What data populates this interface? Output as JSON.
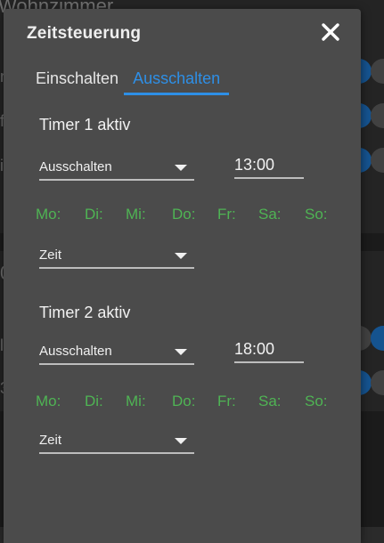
{
  "background": {
    "title": "Wohnzimmer",
    "letters": [
      "r",
      "f",
      "i",
      "0",
      "l",
      "3"
    ]
  },
  "dialog": {
    "title": "Zeitsteuerung",
    "close_icon": "close-icon",
    "tabs": [
      {
        "label": "Einschalten",
        "active": false
      },
      {
        "label": "Ausschalten",
        "active": true
      }
    ],
    "timers": [
      {
        "heading": "Timer 1 aktiv",
        "action": "Ausschalten",
        "time": "13:00",
        "days": [
          "Mo:",
          "Di:",
          "Mi:",
          "Do:",
          "Fr:",
          "Sa:",
          "So:"
        ],
        "mode": "Zeit"
      },
      {
        "heading": "Timer 2 aktiv",
        "action": "Ausschalten",
        "time": "18:00",
        "days": [
          "Mo:",
          "Di:",
          "Mi:",
          "Do:",
          "Fr:",
          "Sa:",
          "So:"
        ],
        "mode": "Zeit"
      }
    ]
  },
  "colors": {
    "accent": "#2e8fe6",
    "day_active": "#4fb454",
    "dialog_bg": "#4b4b4b"
  }
}
